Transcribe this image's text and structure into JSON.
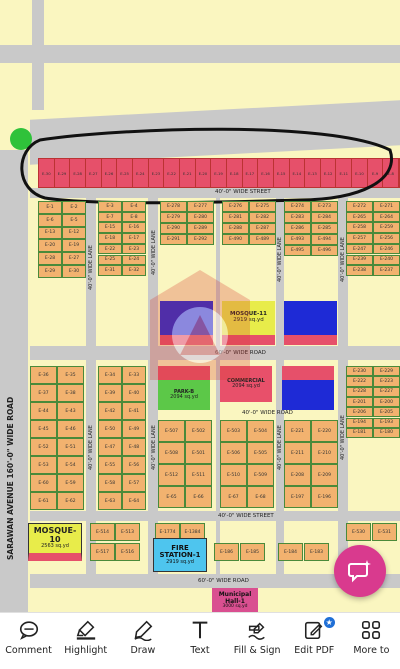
{
  "map": {
    "roads": {
      "street_40_top": "40'-0\" WIDE STREET",
      "road_60_mid": "60'-0\" WIDE ROAD",
      "road_40_mid": "40'-0\" WIDE ROAD",
      "street_40_low": "40'-0\" WIDE STREET",
      "road_60_low": "60'-0\" WIDE ROAD",
      "avenue": "SARAWAN AVENUE 160'-0\" WIDE ROAD",
      "lane": "40'-0\" WIDE LANE"
    },
    "blocks": {
      "mosque11": {
        "title": "MOSQUE-11",
        "area": "2919 sq.yd"
      },
      "park": {
        "title": "PARK-B",
        "area": "2094 sq.yd"
      },
      "commercial": {
        "title": "COMMERCIAL",
        "area": "2094 sq.yd"
      },
      "mosque10": {
        "title": "MOSQUE-10",
        "area": "2563 sq.yd"
      },
      "fire": {
        "title": "FIRE STATION-1",
        "area": "2919 sq.yd"
      },
      "municipal": {
        "title": "Municipal Hall-1",
        "area": "3000 sq.yd"
      }
    },
    "col1": [
      "E-1",
      "E-2",
      "E-6",
      "E-5",
      "E-13",
      "E-12",
      "E-20",
      "E-19",
      "E-28",
      "E-27",
      "E-29",
      "E-30"
    ],
    "col2": [
      "E-3",
      "E-4",
      "E-7",
      "E-8",
      "E-15",
      "E-16",
      "E-18",
      "E-17",
      "E-22",
      "E-23",
      "E-25",
      "E-24",
      "E-31",
      "E-32"
    ],
    "col3": [
      "E-278",
      "E-277",
      "E-279",
      "E-280",
      "E-290",
      "E-289",
      "E-291",
      "E-292"
    ],
    "col4": [
      "E-276",
      "E-275",
      "E-281",
      "E-282",
      "E-288",
      "E-287",
      "E-490",
      "E-489"
    ],
    "col5": [
      "E-274",
      "E-273",
      "E-283",
      "E-284",
      "E-286",
      "E-285",
      "E-493",
      "E-494",
      "E-495",
      "E-496"
    ],
    "col6": [
      "E-272",
      "E-271",
      "E-265",
      "E-264",
      "E-258",
      "E-259",
      "E-257",
      "E-256",
      "E-247",
      "E-246",
      "E-239",
      "E-240",
      "E-238",
      "E-237"
    ],
    "col1b": [
      "E-36",
      "E-35",
      "E-37",
      "E-38",
      "E-44",
      "E-43",
      "E-45",
      "E-46",
      "E-52",
      "E-51",
      "E-53",
      "E-54",
      "E-60",
      "E-59",
      "E-61",
      "E-62"
    ],
    "col2b": [
      "E-34",
      "E-33",
      "E-39",
      "E-40",
      "E-42",
      "E-41",
      "E-50",
      "E-49",
      "E-47",
      "E-48",
      "E-55",
      "E-56",
      "E-58",
      "E-57",
      "E-63",
      "E-64"
    ],
    "col3b": [
      "E-507",
      "E-502",
      "E-508",
      "E-501",
      "E-512",
      "E-511",
      "E-65",
      "E-66"
    ],
    "col4b": [
      "E-503",
      "E-504",
      "E-506",
      "E-505",
      "E-510",
      "E-509",
      "E-67",
      "E-68"
    ],
    "col5b": [
      "E-221",
      "E-220",
      "E-211",
      "E-210",
      "E-208",
      "E-209",
      "E-197",
      "E-196"
    ],
    "col6b": [
      "E-230",
      "E-229",
      "E-222",
      "E-223",
      "E-228",
      "E-227",
      "E-201",
      "E-200",
      "E-206",
      "E-205",
      "E-194",
      "E-193",
      "E-181",
      "E-180"
    ],
    "row_low": [
      "E-514",
      "E-513",
      "E-517",
      "E-516",
      "E-1774",
      "E-1384",
      "E-186",
      "E-185",
      "E-184",
      "E-183",
      "E-530",
      "E-531"
    ],
    "strip_top": [
      "E-30",
      "E-29",
      "E-28",
      "E-27",
      "E-26",
      "E-25",
      "E-24",
      "E-23",
      "E-22",
      "E-21",
      "E-20",
      "E-19",
      "E-18",
      "E-17",
      "E-16",
      "E-15",
      "E-14",
      "E-13",
      "E-12",
      "E-11",
      "E-10",
      "E-9",
      "E-8"
    ]
  },
  "toolbar": {
    "comment": "Comment",
    "highlight": "Highlight",
    "draw": "Draw",
    "text": "Text",
    "fill_sign": "Fill & Sign",
    "edit_pdf": "Edit PDF",
    "more": "More to"
  },
  "colors": {
    "plot": "#f2b26f",
    "road": "#c9c9c9",
    "highlight_strip": "#e6506a",
    "accent_fab": "#d93a8e",
    "mosque": "#e8ec4a",
    "park": "#5cc848",
    "blue_block": "#1e2ad6",
    "fire": "#4ec5ee"
  }
}
